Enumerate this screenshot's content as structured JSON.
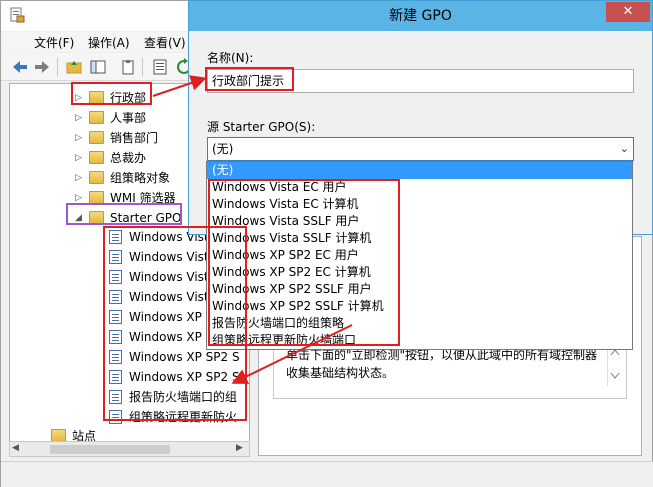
{
  "gpmc": {
    "menu": [
      "文件(F)",
      "操作(A)",
      "查看(V)"
    ],
    "tree": [
      {
        "label": "行政部",
        "kind": "folder"
      },
      {
        "label": "人事部",
        "kind": "folder"
      },
      {
        "label": "销售部门",
        "kind": "folder"
      },
      {
        "label": "总裁办",
        "kind": "folder"
      },
      {
        "label": "组策略对象",
        "kind": "folder"
      },
      {
        "label": "WMI 筛选器",
        "kind": "folder"
      },
      {
        "label": "Starter GPO",
        "kind": "folder",
        "expanded": true
      }
    ],
    "starter_gpos": [
      "Windows Vista",
      "Windows Vista",
      "Windows Vista",
      "Windows Vista",
      "Windows XP S",
      "Windows XP S",
      "Windows XP SP2 S",
      "Windows XP SP2 S",
      "报告防火墙端口的组",
      "组策略远程更新防火"
    ],
    "sites_label": "站点",
    "right_text": "单击下面的\"立即检测\"按钮，以便从此域中的所有域控制器收集基础结构状态。"
  },
  "dialog": {
    "title": "新建 GPO",
    "close_glyph": "✕",
    "name_label": "名称(N):",
    "name_value": "行政部门提示",
    "source_label": "源 Starter GPO(S):",
    "source_value": "(无)",
    "combo_arrow": "⌄",
    "options": [
      "(无)",
      "Windows Vista EC 用户",
      "Windows Vista EC 计算机",
      "Windows Vista SSLF 用户",
      "Windows Vista SSLF 计算机",
      "Windows XP SP2 EC 用户",
      "Windows XP SP2 EC 计算机",
      "Windows XP SP2 SSLF 用户",
      "Windows XP SP2 SSLF 计算机",
      "报告防火墙端口的组策略",
      "组策略远程更新防火墙端口"
    ],
    "selected_option": "(无)"
  },
  "colors": {
    "dialog_title": "#5ab4e6",
    "selection": "#3399ff",
    "annotation_red": "#e02020",
    "annotation_purple": "#9b59d0"
  }
}
